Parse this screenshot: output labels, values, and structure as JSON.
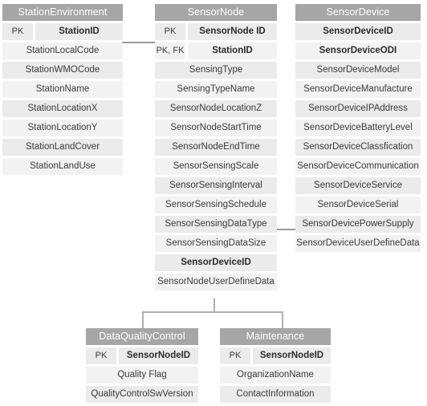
{
  "diagram": {
    "type": "entity-relationship-diagram",
    "title": "Sensor data model ER diagram",
    "header_color": "#a6a6a6",
    "row_color_a": "#ebebeb",
    "row_color_b": "#f2f2f2",
    "connector_color": "#9a9a9a"
  },
  "entities": [
    {
      "id": "station_environment",
      "name": "StationEnvironment",
      "attributes": [
        {
          "key": "PK",
          "name": "StationID",
          "bold": true
        },
        {
          "key": "",
          "name": "StationLocalCode",
          "bold": false
        },
        {
          "key": "",
          "name": "StationWMOCode",
          "bold": false
        },
        {
          "key": "",
          "name": "StationName",
          "bold": false
        },
        {
          "key": "",
          "name": "StationLocationX",
          "bold": false
        },
        {
          "key": "",
          "name": "StationLocationY",
          "bold": false
        },
        {
          "key": "",
          "name": "StationLandCover",
          "bold": false
        },
        {
          "key": "",
          "name": "StationLandUse",
          "bold": false
        }
      ]
    },
    {
      "id": "sensor_node",
      "name": "SensorNode",
      "attributes": [
        {
          "key": "PK",
          "name": "SensorNode ID",
          "bold": true
        },
        {
          "key": "PK, FK",
          "name": "StationID",
          "bold": true
        },
        {
          "key": "",
          "name": "SensingType",
          "bold": false
        },
        {
          "key": "",
          "name": "SensingTypeName",
          "bold": false
        },
        {
          "key": "",
          "name": "SensorNodeLocationZ",
          "bold": false
        },
        {
          "key": "",
          "name": "SensorNodeStartTime",
          "bold": false
        },
        {
          "key": "",
          "name": "SensorNodeEndTime",
          "bold": false
        },
        {
          "key": "",
          "name": "SensorSensingScale",
          "bold": false
        },
        {
          "key": "",
          "name": "SensorSensingInterval",
          "bold": false
        },
        {
          "key": "",
          "name": "SensorSensingSchedule",
          "bold": false
        },
        {
          "key": "",
          "name": "SensorSensingDataType",
          "bold": false
        },
        {
          "key": "",
          "name": "SensorSensingDataSize",
          "bold": false
        },
        {
          "key": "",
          "name": "SensorDeviceID",
          "bold": true
        },
        {
          "key": "",
          "name": "SensorNodeUserDefineData",
          "bold": false
        }
      ]
    },
    {
      "id": "sensor_device",
      "name": "SensorDevice",
      "attributes": [
        {
          "key": "",
          "name": "SensorDeviceID",
          "bold": true
        },
        {
          "key": "",
          "name": "SensorDeviceODI",
          "bold": true
        },
        {
          "key": "",
          "name": "SensorDeviceModel",
          "bold": false
        },
        {
          "key": "",
          "name": "SensorDeviceManufacture",
          "bold": false
        },
        {
          "key": "",
          "name": "SensorDeviceIPAddress",
          "bold": false
        },
        {
          "key": "",
          "name": "SensorDeviceBatteryLevel",
          "bold": false
        },
        {
          "key": "",
          "name": "SensorDeviceClassfication",
          "bold": false
        },
        {
          "key": "",
          "name": "SensorDeviceCommunication",
          "bold": false
        },
        {
          "key": "",
          "name": "SensorDeviceService",
          "bold": false
        },
        {
          "key": "",
          "name": "SensorDeviceSerial",
          "bold": false
        },
        {
          "key": "",
          "name": "SensorDevicePowerSupply",
          "bold": false
        },
        {
          "key": "",
          "name": "SensorDeviceUserDefineData",
          "bold": false
        }
      ]
    },
    {
      "id": "data_quality_control",
      "name": "DataQualityControl",
      "attributes": [
        {
          "key": "PK",
          "name": "SensorNodeID",
          "bold": true
        },
        {
          "key": "",
          "name": "Quality Flag",
          "bold": false
        },
        {
          "key": "",
          "name": "QualityControlSwVersion",
          "bold": false
        }
      ]
    },
    {
      "id": "maintenance",
      "name": "Maintenance",
      "attributes": [
        {
          "key": "PK",
          "name": "SensorNodeID",
          "bold": true
        },
        {
          "key": "",
          "name": "OrganizationName",
          "bold": false
        },
        {
          "key": "",
          "name": "ContactInformation",
          "bold": false
        }
      ]
    }
  ],
  "relationships": [
    {
      "from": "station_environment",
      "to": "sensor_node",
      "via": "StationID"
    },
    {
      "from": "sensor_node",
      "to": "sensor_device",
      "via": "SensorDeviceID"
    },
    {
      "from": "sensor_node",
      "to": "data_quality_control",
      "via": "SensorNodeID"
    },
    {
      "from": "sensor_node",
      "to": "maintenance",
      "via": "SensorNodeID"
    }
  ]
}
